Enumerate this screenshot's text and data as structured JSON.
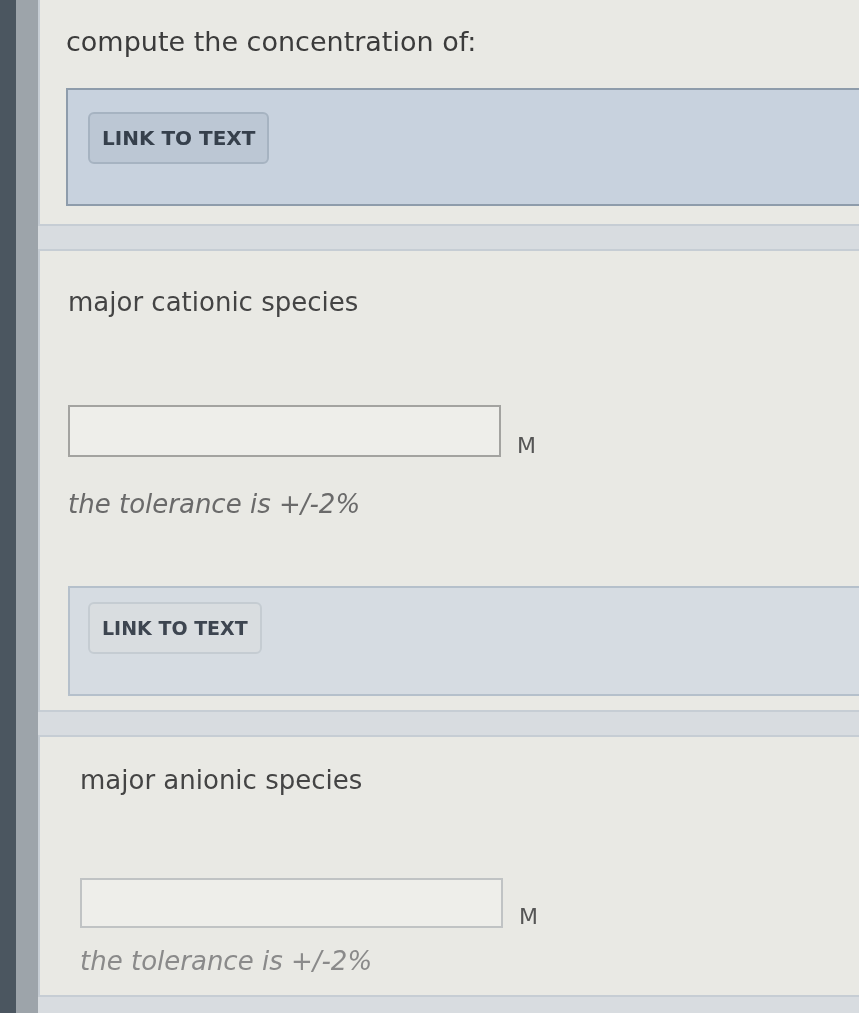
{
  "intro": {
    "text": "compute the concentration of:",
    "link_button": "LINK TO TEXT"
  },
  "questions": [
    {
      "label": "major cationic species",
      "unit": "M",
      "tolerance": "the tolerance is +/-2%",
      "link_button": "LINK TO TEXT"
    },
    {
      "label": "major anionic species",
      "unit": "M",
      "tolerance": "the tolerance is +/-2%"
    }
  ]
}
